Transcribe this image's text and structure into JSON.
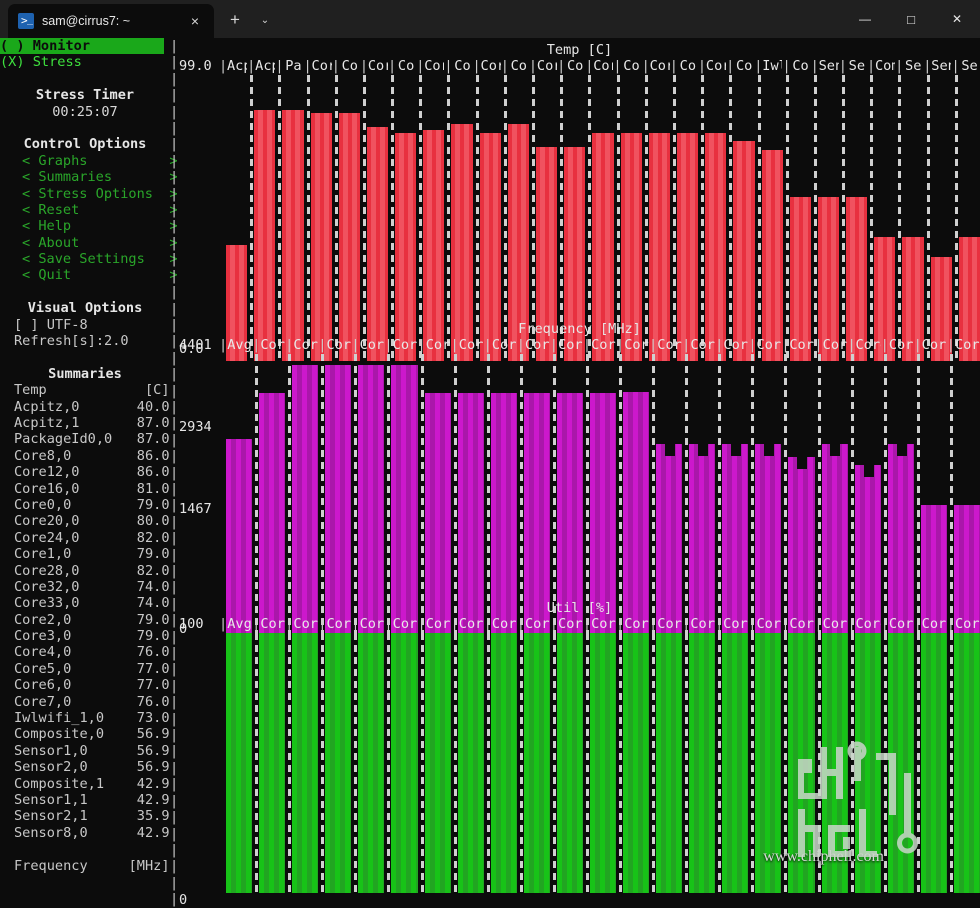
{
  "window": {
    "tab_title": "sam@cirrus7: ~",
    "tab_icon": "terminal-icon",
    "new_tab_label": "+",
    "tab_menu_label": "⌄",
    "close_tab_label": "×",
    "minimize_label": "—",
    "maximize_label": "□",
    "close_label": "✕"
  },
  "sidebar": {
    "modes": [
      {
        "label": "( ) Monitor",
        "selected": true
      },
      {
        "label": "(X) Stress",
        "selected": false
      }
    ],
    "stress_timer": {
      "title": "Stress Timer",
      "value": "00:25:07"
    },
    "control_options": {
      "title": "Control Options",
      "items": [
        "< Graphs          >",
        "< Summaries       >",
        "< Stress Options  >",
        "< Reset           >",
        "< Help            >",
        "< About           >",
        "< Save Settings   >",
        "< Quit            >"
      ]
    },
    "visual_options": {
      "title": "Visual Options",
      "utf8": "[ ] UTF-8",
      "refresh": "Refresh[s]:2.0"
    },
    "summaries": {
      "title": "Summaries",
      "temp_header": {
        "name": "Temp",
        "unit": "[C]"
      },
      "temp_rows": [
        {
          "name": "Acpitz,0",
          "value": "40.0"
        },
        {
          "name": "Acpitz,1",
          "value": "87.0"
        },
        {
          "name": "PackageId0,0",
          "value": "87.0"
        },
        {
          "name": "Core8,0",
          "value": "86.0"
        },
        {
          "name": "Core12,0",
          "value": "86.0"
        },
        {
          "name": "Core16,0",
          "value": "81.0"
        },
        {
          "name": "Core0,0",
          "value": "79.0"
        },
        {
          "name": "Core20,0",
          "value": "80.0"
        },
        {
          "name": "Core24,0",
          "value": "82.0"
        },
        {
          "name": "Core1,0",
          "value": "79.0"
        },
        {
          "name": "Core28,0",
          "value": "82.0"
        },
        {
          "name": "Core32,0",
          "value": "74.0"
        },
        {
          "name": "Core33,0",
          "value": "74.0"
        },
        {
          "name": "Core2,0",
          "value": "79.0"
        },
        {
          "name": "Core3,0",
          "value": "79.0"
        },
        {
          "name": "Core4,0",
          "value": "76.0"
        },
        {
          "name": "Core5,0",
          "value": "77.0"
        },
        {
          "name": "Core6,0",
          "value": "77.0"
        },
        {
          "name": "Core7,0",
          "value": "76.0"
        },
        {
          "name": "Iwlwifi_1,0",
          "value": "73.0"
        },
        {
          "name": "Composite,0",
          "value": "56.9"
        },
        {
          "name": "Sensor1,0",
          "value": "56.9"
        },
        {
          "name": "Sensor2,0",
          "value": "56.9"
        },
        {
          "name": "Composite,1",
          "value": "42.9"
        },
        {
          "name": "Sensor1,1",
          "value": "42.9"
        },
        {
          "name": "Sensor2,1",
          "value": "35.9"
        },
        {
          "name": "Sensor8,0",
          "value": "42.9"
        }
      ],
      "freq_header": {
        "name": "Frequency",
        "unit": "[MHz]"
      }
    }
  },
  "chart_data": [
    {
      "type": "bar",
      "title": "Temp [C]",
      "ylabel": "Temp",
      "unit": "[C]",
      "ymax_label": "99.0",
      "ymin_label": "0.0",
      "ylim": [
        0,
        99.0
      ],
      "color": "#e8303f",
      "categories": [
        "Acp",
        "Acp",
        "Pa",
        "Cor",
        "Co",
        "Cor",
        "Co",
        "Cor",
        "Co",
        "Cor",
        "Co",
        "Cor",
        "Co",
        "Cor",
        "Co",
        "Cor",
        "Co",
        "Cor",
        "Co",
        "Iwl",
        "Co",
        "Sen",
        "Se",
        "Com",
        "Se",
        "Sen",
        "Se"
      ],
      "values": [
        40.0,
        87.0,
        87.0,
        86.0,
        86.0,
        81.0,
        79.0,
        80.0,
        82.0,
        79.0,
        82.0,
        74.0,
        74.0,
        79.0,
        79.0,
        79.0,
        79.0,
        79.0,
        76.0,
        73.0,
        56.9,
        56.9,
        56.9,
        42.9,
        42.9,
        35.9,
        42.9
      ]
    },
    {
      "type": "bar",
      "title": "Frequency [MHz]",
      "ylabel": "Frequency",
      "unit": "[MHz]",
      "ymax_label": "4401",
      "ymid_hi_label": "2934",
      "ymid_lo_label": "1467",
      "ymin_label": "0",
      "ylim": [
        0,
        4401
      ],
      "color": "#cc18cc",
      "categories": [
        "Avg",
        "Cor",
        "Cor",
        "Cor",
        "Cor",
        "Cor",
        "Cor",
        "Cor",
        "Cor",
        "Cor",
        "Cor",
        "Cor",
        "Cor",
        "Cor",
        "Cor",
        "Cor",
        "Cor",
        "Core",
        "Cor",
        "Core",
        "Cor",
        "Core",
        "Cor"
      ],
      "values": [
        3100,
        3800,
        4230,
        4230,
        4230,
        4230,
        3800,
        3800,
        3800,
        3800,
        3800,
        3800,
        3820,
        3020,
        3020,
        3020,
        3020,
        2820,
        3020,
        2700,
        3020,
        2080,
        2080
      ],
      "notched": [
        false,
        false,
        false,
        false,
        false,
        false,
        false,
        false,
        false,
        false,
        false,
        false,
        false,
        true,
        true,
        true,
        true,
        true,
        true,
        true,
        true,
        false,
        false
      ]
    },
    {
      "type": "bar",
      "title": "Util [%]",
      "ylabel": "Util",
      "unit": "[%]",
      "ymax_label": "100",
      "ymin_label": "0",
      "ylim": [
        0,
        100
      ],
      "color": "#17c317",
      "categories": [
        "Avg",
        "Cor",
        "Cor",
        "Cor",
        "Cor",
        "Cor",
        "Cor",
        "Cor",
        "Cor",
        "Cor",
        "Cor",
        "Cor",
        "Cor",
        "Cor",
        "Cor",
        "Core",
        "Cor",
        "Core",
        "Cor",
        "Core",
        "Cor",
        "Core",
        "Cor"
      ],
      "values": [
        100,
        100,
        100,
        100,
        100,
        100,
        100,
        100,
        100,
        100,
        100,
        100,
        100,
        100,
        100,
        100,
        100,
        100,
        100,
        100,
        100,
        100,
        100
      ]
    }
  ],
  "watermark": {
    "url": "www.chiphell.com",
    "logo": "chiphell-logo"
  }
}
